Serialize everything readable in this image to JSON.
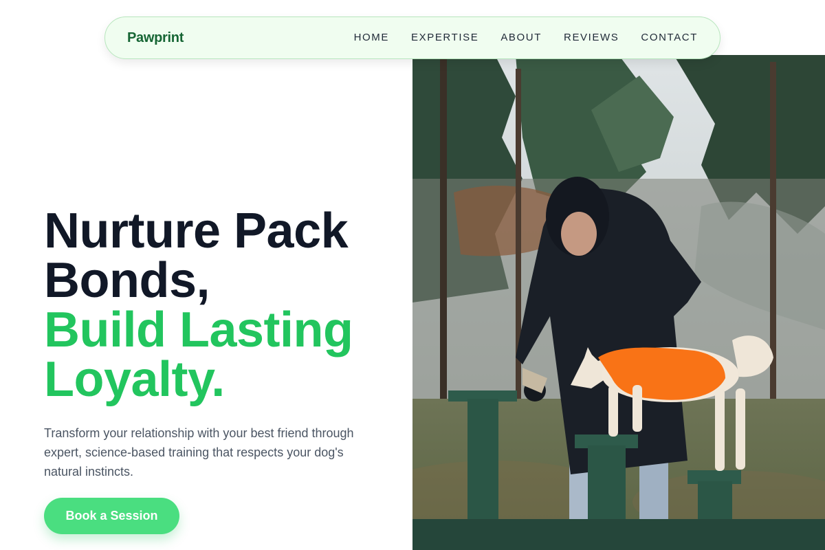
{
  "nav": {
    "brand": "Pawprint",
    "links": [
      "HOME",
      "EXPERTISE",
      "ABOUT",
      "REVIEWS",
      "CONTACT"
    ]
  },
  "hero": {
    "headline_line1": "Nurture Pack",
    "headline_line2": "Bonds,",
    "headline_line3": "Build Lasting",
    "headline_line4": "Loyalty.",
    "subtitle": "Transform your relationship with your best friend through expert, science-based training that respects your dog's natural instincts.",
    "cta_label": "Book a Session"
  },
  "colors": {
    "brand": "#166534",
    "accent": "#22c55e",
    "cta": "#4ade80",
    "nav_bg": "#f0fdf0",
    "heading": "#111827"
  }
}
